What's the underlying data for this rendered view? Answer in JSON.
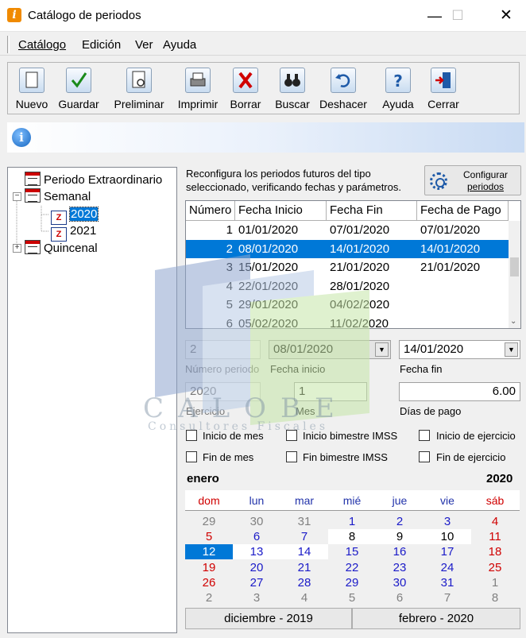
{
  "window": {
    "title": "Catálogo de periodos",
    "minimize": "—",
    "maximize": "☐",
    "close": "✕"
  },
  "menu": {
    "items": [
      "Catálogo",
      "Edición",
      "Ver",
      "Ayuda"
    ]
  },
  "toolbar": {
    "items": [
      {
        "label": "Nuevo",
        "icon": "new-document-icon"
      },
      {
        "label": "Guardar",
        "icon": "checkmark-icon"
      },
      {
        "label": "Preliminar",
        "icon": "print-preview-icon"
      },
      {
        "label": "Imprimir",
        "icon": "printer-icon"
      },
      {
        "label": "Borrar",
        "icon": "delete-x-icon"
      },
      {
        "label": "Buscar",
        "icon": "binoculars-icon"
      },
      {
        "label": "Deshacer",
        "icon": "undo-icon"
      },
      {
        "label": "Ayuda",
        "icon": "help-icon"
      },
      {
        "label": "Cerrar",
        "icon": "exit-door-icon"
      }
    ]
  },
  "info": {
    "icon": "i"
  },
  "tree": {
    "items": [
      {
        "label": "Periodo Extraordinario"
      },
      {
        "label": "Semanal",
        "expander": "−"
      },
      {
        "label": "2020",
        "selected": true
      },
      {
        "label": "2021"
      },
      {
        "label": "Quincenal",
        "expander": "+"
      }
    ]
  },
  "config": {
    "description": "Reconfigura los periodos futuros del tipo seleccionado, verificando fechas y parámetros.",
    "button_line1": "Configurar",
    "button_line2": "periodos"
  },
  "grid": {
    "headers": [
      "Número",
      "Fecha Inicio",
      "Fecha Fin",
      "Fecha de Pago"
    ],
    "rows": [
      [
        "1",
        "01/01/2020",
        "07/01/2020",
        "07/01/2020"
      ],
      [
        "2",
        "08/01/2020",
        "14/01/2020",
        "14/01/2020"
      ],
      [
        "3",
        "15/01/2020",
        "21/01/2020",
        "21/01/2020"
      ],
      [
        "4",
        "22/01/2020",
        "28/01/2020",
        ""
      ],
      [
        "5",
        "29/01/2020",
        "04/02/2020",
        ""
      ],
      [
        "6",
        "05/02/2020",
        "11/02/2020",
        ""
      ]
    ],
    "selected_row": 1
  },
  "form": {
    "numero_periodo": "2",
    "numero_periodo_label": "Número periodo",
    "fecha_inicio": "08/01/2020",
    "fecha_inicio_label": "Fecha inicio",
    "fecha_fin": "14/01/2020",
    "fecha_fin_label": "Fecha fin",
    "ejercicio": "2020",
    "ejercicio_label": "Ejercicio",
    "mes": "1",
    "mes_label": "Mes",
    "dias_pago": "6.00",
    "dias_pago_label": "Días de pago",
    "dropdown_arrow": "▼"
  },
  "checks": [
    {
      "label": "Inicio de mes",
      "checked": false
    },
    {
      "label": "Inicio bimestre IMSS",
      "checked": false
    },
    {
      "label": "Inicio de ejercicio",
      "checked": false
    },
    {
      "label": "Fin de mes",
      "checked": false
    },
    {
      "label": "Fin bimestre IMSS",
      "checked": false
    },
    {
      "label": "Fin de ejercicio",
      "checked": false
    }
  ],
  "calendar": {
    "month": "enero",
    "year": "2020",
    "weekdays": [
      "dom",
      "lun",
      "mar",
      "mié",
      "jue",
      "vie",
      "sáb"
    ],
    "weeks": [
      [
        "29",
        "30",
        "31",
        "1",
        "2",
        "3",
        "4"
      ],
      [
        "5",
        "6",
        "7",
        "8",
        "9",
        "10",
        "11"
      ],
      [
        "12",
        "13",
        "14",
        "15",
        "16",
        "17",
        "18"
      ],
      [
        "19",
        "20",
        "21",
        "22",
        "23",
        "24",
        "25"
      ],
      [
        "26",
        "27",
        "28",
        "29",
        "30",
        "31",
        "1"
      ],
      [
        "2",
        "3",
        "4",
        "5",
        "6",
        "7",
        "8"
      ]
    ],
    "prev_month": "diciembre - 2019",
    "next_month": "febrero - 2020"
  },
  "watermark": {
    "title": "CALOBE",
    "subtitle": "Consultores Fiscales"
  }
}
